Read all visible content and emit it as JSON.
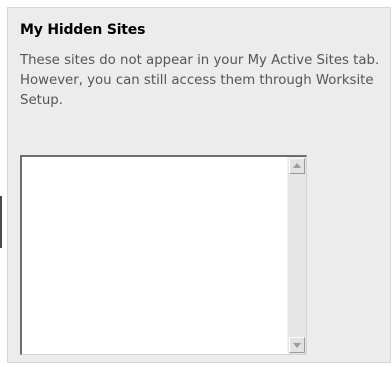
{
  "panel": {
    "title": "My Hidden Sites",
    "description": "These sites do not appear in your My Active Sites tab. However, you can still access them through Worksite Setup."
  },
  "listbox": {
    "items": [],
    "scroll_up_icon": "arrow-up-icon",
    "scroll_down_icon": "arrow-down-icon"
  }
}
